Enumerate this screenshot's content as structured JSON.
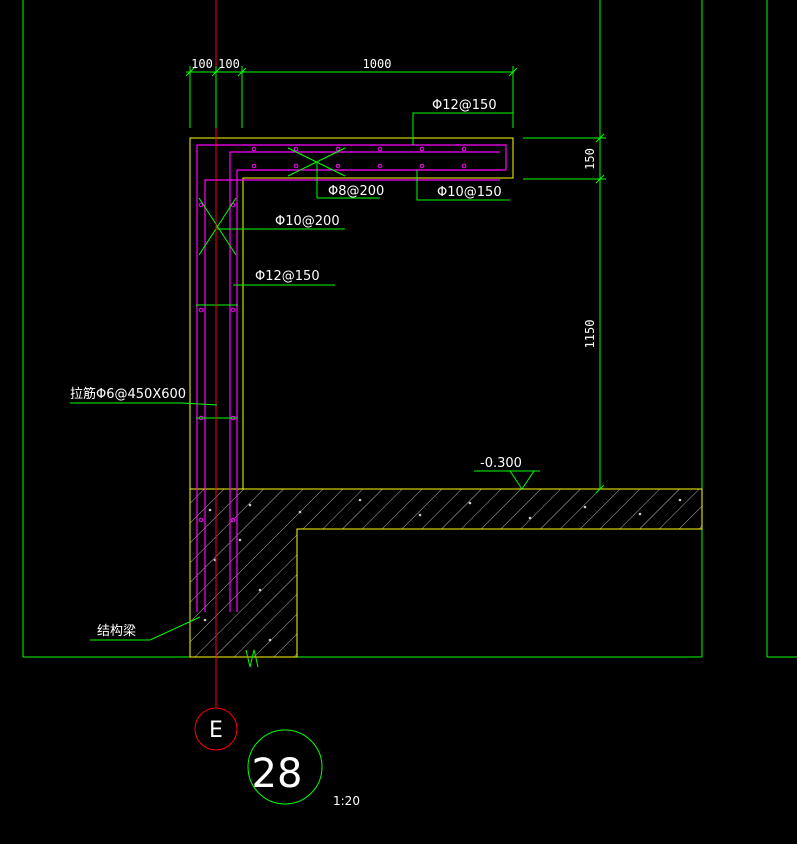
{
  "drawing": {
    "dimensions": {
      "top_left": "100",
      "top_mid": "100",
      "top_right": "1000",
      "right_top": "150",
      "right_main": "1150"
    },
    "labels": {
      "rebar_top": "Φ12@150",
      "rebar_bottom": "Φ10@150",
      "rebar_tie": "Φ8@200",
      "rebar_wall_1": "Φ10@200",
      "rebar_wall_2": "Φ12@150",
      "tie_note": "拉筋Φ6@450X600",
      "level": "-0.300",
      "struct_beam": "结构梁"
    },
    "axis": {
      "id": "E"
    },
    "detail": {
      "number": "28",
      "scale": "1:20"
    },
    "colors": {
      "background": "#000000",
      "green": "#00ff00",
      "yellow": "#ffff00",
      "magenta": "#ff00ff",
      "red": "#ff0000",
      "white": "#ffffff"
    }
  }
}
